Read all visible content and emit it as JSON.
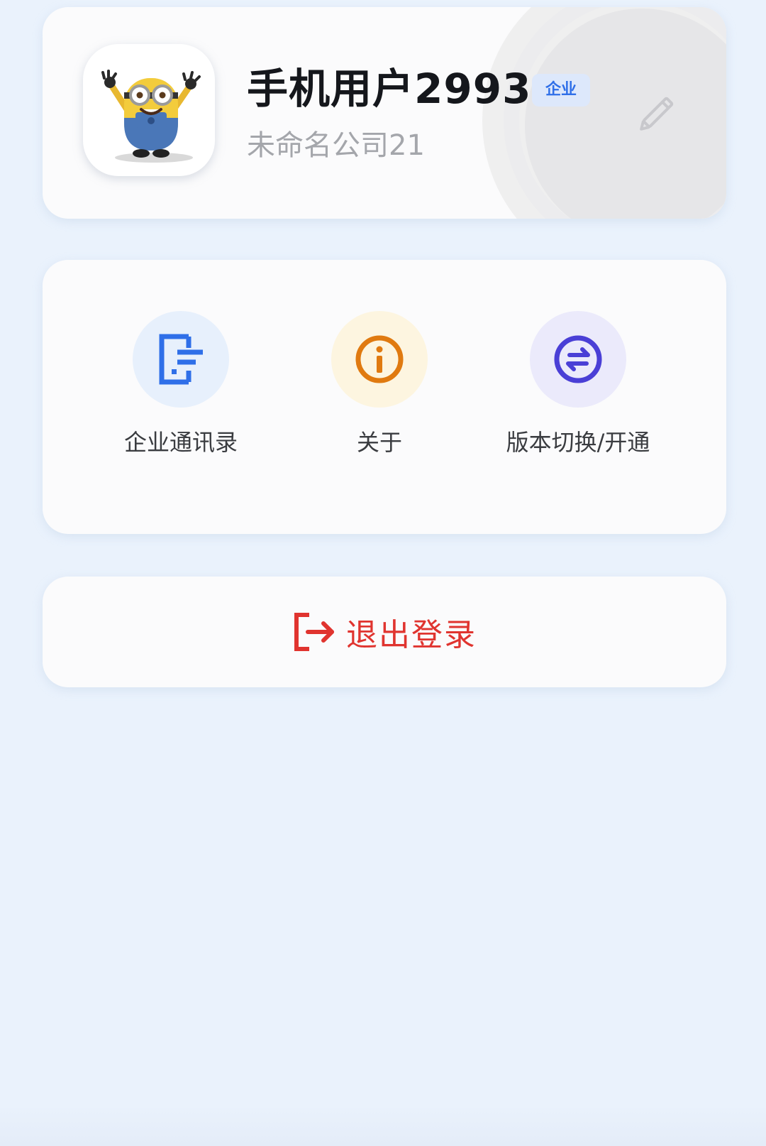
{
  "profile": {
    "name": "手机用户2993",
    "badge": "企业",
    "company": "未命名公司21",
    "avatar_icon": "minion-avatar",
    "edit_icon": "pencil-icon"
  },
  "menu": {
    "items": [
      {
        "label": "企业通讯录",
        "icon": "contacts-book-icon",
        "color": "#2f6fe8"
      },
      {
        "label": "关于",
        "icon": "info-icon",
        "color": "#e07a10"
      },
      {
        "label": "版本切换/开通",
        "icon": "switch-arrows-icon",
        "color": "#4a3fd6"
      }
    ]
  },
  "logout": {
    "label": "退出登录",
    "icon": "logout-icon",
    "color": "#e0342f"
  },
  "colors": {
    "background": "#eaf2fc",
    "card": "#fbfbfc",
    "badge_bg": "#dde8fb",
    "badge_text": "#2f6fe8"
  }
}
